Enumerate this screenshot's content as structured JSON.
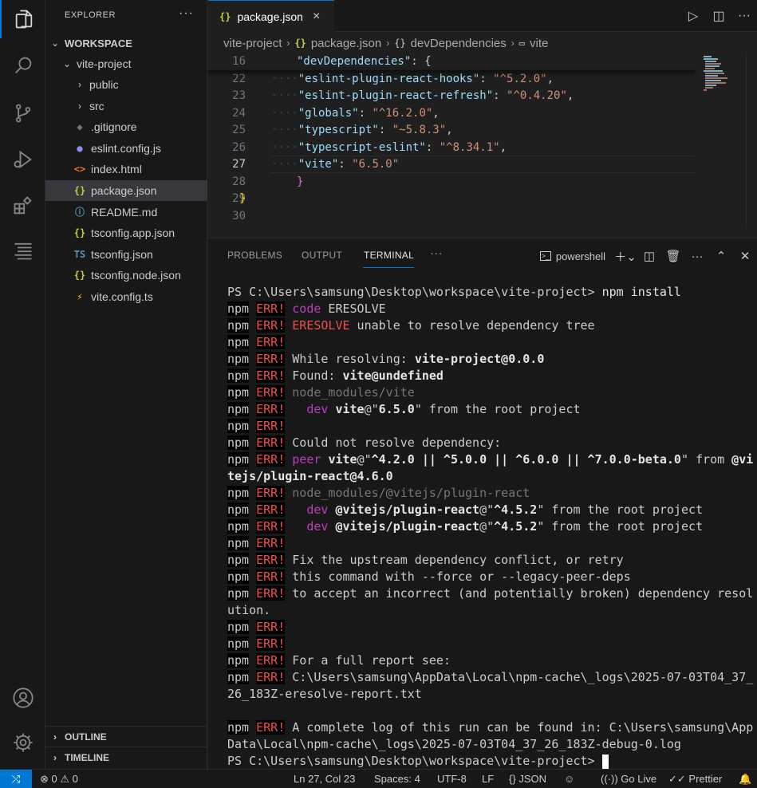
{
  "activity_bar": {
    "items": [
      "explorer-icon",
      "search-icon",
      "source-control-icon",
      "run-debug-icon",
      "extensions-icon",
      "outline-icon"
    ],
    "bottom": [
      "account-icon",
      "settings-gear-icon"
    ]
  },
  "sidebar": {
    "title": "EXPLORER",
    "more": "···",
    "workspace": "WORKSPACE",
    "project": "vite-project",
    "items": [
      {
        "label": "public",
        "type": "folder"
      },
      {
        "label": "src",
        "type": "folder"
      },
      {
        "label": ".gitignore",
        "type": "file",
        "icon": "◆",
        "color": "#6e7681"
      },
      {
        "label": "eslint.config.js",
        "type": "file",
        "icon": "●",
        "color": "#8d8df5"
      },
      {
        "label": "index.html",
        "type": "file",
        "icon": "<>",
        "color": "#e37933"
      },
      {
        "label": "package.json",
        "type": "file",
        "icon": "{}",
        "color": "#cbcb41",
        "selected": true
      },
      {
        "label": "README.md",
        "type": "file",
        "icon": "ⓘ",
        "color": "#519aba"
      },
      {
        "label": "tsconfig.app.json",
        "type": "file",
        "icon": "{}",
        "color": "#cbcb41"
      },
      {
        "label": "tsconfig.json",
        "type": "file",
        "icon": "TS",
        "color": "#519aba"
      },
      {
        "label": "tsconfig.node.json",
        "type": "file",
        "icon": "{}",
        "color": "#cbcb41"
      },
      {
        "label": "vite.config.ts",
        "type": "file",
        "icon": "⚡",
        "color": "#ffd700"
      }
    ],
    "sections": [
      "OUTLINE",
      "TIMELINE"
    ]
  },
  "tab": {
    "label": "package.json",
    "icon": "{}",
    "close": "×"
  },
  "breadcrumb": {
    "items": [
      "vite-project",
      "package.json",
      "devDependencies",
      "vite"
    ]
  },
  "editor": {
    "lines": [
      {
        "n": "16",
        "indent": "  ",
        "key": "\"devDependencies\"",
        "val": "",
        "tail": ": {",
        "sticky": true
      },
      {
        "n": "22",
        "indent": "    ",
        "key": "\"eslint-plugin-react-hooks\"",
        "val": "\"^5.2.0\"",
        "tail": ","
      },
      {
        "n": "23",
        "indent": "    ",
        "key": "\"eslint-plugin-react-refresh\"",
        "val": "\"^0.4.20\"",
        "tail": ","
      },
      {
        "n": "24",
        "indent": "    ",
        "key": "\"globals\"",
        "val": "\"^16.2.0\"",
        "tail": ","
      },
      {
        "n": "25",
        "indent": "    ",
        "key": "\"typescript\"",
        "val": "\"~5.8.3\"",
        "tail": ","
      },
      {
        "n": "26",
        "indent": "    ",
        "key": "\"typescript-eslint\"",
        "val": "\"^8.34.1\"",
        "tail": ","
      },
      {
        "n": "27",
        "indent": "    ",
        "key": "\"vite\"",
        "val": "\"6.5.0\"",
        "tail": "",
        "active": true
      },
      {
        "n": "28",
        "indent": "  ",
        "key": "",
        "val": "",
        "tail": "}",
        "brace": true
      },
      {
        "n": "29",
        "indent": "",
        "key": "",
        "val": "",
        "tail": "}",
        "brace0": true
      },
      {
        "n": "30",
        "indent": "",
        "key": "",
        "val": "",
        "tail": ""
      }
    ]
  },
  "panel": {
    "tabs": [
      "PROBLEMS",
      "OUTPUT",
      "TERMINAL",
      "···"
    ],
    "active_tab": "TERMINAL",
    "shell": "powershell"
  },
  "terminal": {
    "prompt_cmd_prefix": "PS C:\\Users\\samsung\\Desktop\\workspace\\vite-project> ",
    "command": "npm install",
    "final_prompt": "PS C:\\Users\\samsung\\Desktop\\workspace\\vite-project> ",
    "lines": [
      [
        {
          "t": "npm",
          "c": "npm"
        },
        {
          "t": " "
        },
        {
          "t": "ERR!",
          "c": "err"
        },
        {
          "t": " "
        },
        {
          "t": "code",
          "c": "mag"
        },
        {
          "t": " ERESOLVE"
        }
      ],
      [
        {
          "t": "npm",
          "c": "npm"
        },
        {
          "t": " "
        },
        {
          "t": "ERR!",
          "c": "err"
        },
        {
          "t": " "
        },
        {
          "t": "ERESOLVE",
          "c": "red"
        },
        {
          "t": " unable to resolve dependency tree"
        }
      ],
      [
        {
          "t": "npm",
          "c": "npm"
        },
        {
          "t": " "
        },
        {
          "t": "ERR!",
          "c": "err"
        }
      ],
      [
        {
          "t": "npm",
          "c": "npm"
        },
        {
          "t": " "
        },
        {
          "t": "ERR!",
          "c": "err"
        },
        {
          "t": " While resolving: "
        },
        {
          "t": "vite-project@0.0.0",
          "c": "bold"
        }
      ],
      [
        {
          "t": "npm",
          "c": "npm"
        },
        {
          "t": " "
        },
        {
          "t": "ERR!",
          "c": "err"
        },
        {
          "t": " Found: "
        },
        {
          "t": "vite@undefined",
          "c": "bold"
        }
      ],
      [
        {
          "t": "npm",
          "c": "npm"
        },
        {
          "t": " "
        },
        {
          "t": "ERR!",
          "c": "err"
        },
        {
          "t": " "
        },
        {
          "t": "node_modules/vite",
          "c": "gray"
        }
      ],
      [
        {
          "t": "npm",
          "c": "npm"
        },
        {
          "t": " "
        },
        {
          "t": "ERR!",
          "c": "err"
        },
        {
          "t": "   "
        },
        {
          "t": "dev",
          "c": "mag"
        },
        {
          "t": " "
        },
        {
          "t": "vite",
          "c": "bold"
        },
        {
          "t": "@\""
        },
        {
          "t": "6.5.0",
          "c": "bold"
        },
        {
          "t": "\" from the root project"
        }
      ],
      [
        {
          "t": "npm",
          "c": "npm"
        },
        {
          "t": " "
        },
        {
          "t": "ERR!",
          "c": "err"
        }
      ],
      [
        {
          "t": "npm",
          "c": "npm"
        },
        {
          "t": " "
        },
        {
          "t": "ERR!",
          "c": "err"
        },
        {
          "t": " Could not resolve dependency:"
        }
      ],
      [
        {
          "t": "npm",
          "c": "npm"
        },
        {
          "t": " "
        },
        {
          "t": "ERR!",
          "c": "err"
        },
        {
          "t": " "
        },
        {
          "t": "peer",
          "c": "mag"
        },
        {
          "t": " "
        },
        {
          "t": "vite",
          "c": "bold"
        },
        {
          "t": "@\""
        },
        {
          "t": "^4.2.0 || ^5.0.0 || ^6.0.0 || ^7.0.0-beta.0",
          "c": "bold"
        },
        {
          "t": "\" from "
        },
        {
          "t": "@vi",
          "c": "bold"
        }
      ],
      [
        {
          "t": "tejs/plugin-react@4.6.0",
          "c": "bold"
        }
      ],
      [
        {
          "t": "npm",
          "c": "npm"
        },
        {
          "t": " "
        },
        {
          "t": "ERR!",
          "c": "err"
        },
        {
          "t": " "
        },
        {
          "t": "node_modules/@vitejs/plugin-react",
          "c": "gray"
        }
      ],
      [
        {
          "t": "npm",
          "c": "npm"
        },
        {
          "t": " "
        },
        {
          "t": "ERR!",
          "c": "err"
        },
        {
          "t": "   "
        },
        {
          "t": "dev",
          "c": "mag"
        },
        {
          "t": " "
        },
        {
          "t": "@vitejs/plugin-react",
          "c": "bold"
        },
        {
          "t": "@\""
        },
        {
          "t": "^4.5.2",
          "c": "bold"
        },
        {
          "t": "\" from the root project"
        }
      ],
      [
        {
          "t": "npm",
          "c": "npm"
        },
        {
          "t": " "
        },
        {
          "t": "ERR!",
          "c": "err"
        },
        {
          "t": "   "
        },
        {
          "t": "dev",
          "c": "mag"
        },
        {
          "t": " "
        },
        {
          "t": "@vitejs/plugin-react",
          "c": "bold"
        },
        {
          "t": "@\""
        },
        {
          "t": "^4.5.2",
          "c": "bold"
        },
        {
          "t": "\" from the root project"
        }
      ],
      [
        {
          "t": "npm",
          "c": "npm"
        },
        {
          "t": " "
        },
        {
          "t": "ERR!",
          "c": "err"
        }
      ],
      [
        {
          "t": "npm",
          "c": "npm"
        },
        {
          "t": " "
        },
        {
          "t": "ERR!",
          "c": "err"
        },
        {
          "t": " Fix the upstream dependency conflict, or retry"
        }
      ],
      [
        {
          "t": "npm",
          "c": "npm"
        },
        {
          "t": " "
        },
        {
          "t": "ERR!",
          "c": "err"
        },
        {
          "t": " this command with --force or --legacy-peer-deps"
        }
      ],
      [
        {
          "t": "npm",
          "c": "npm"
        },
        {
          "t": " "
        },
        {
          "t": "ERR!",
          "c": "err"
        },
        {
          "t": " to accept an incorrect (and potentially broken) dependency resol"
        }
      ],
      [
        {
          "t": "ution."
        }
      ],
      [
        {
          "t": "npm",
          "c": "npm"
        },
        {
          "t": " "
        },
        {
          "t": "ERR!",
          "c": "err"
        }
      ],
      [
        {
          "t": "npm",
          "c": "npm"
        },
        {
          "t": " "
        },
        {
          "t": "ERR!",
          "c": "err"
        }
      ],
      [
        {
          "t": "npm",
          "c": "npm"
        },
        {
          "t": " "
        },
        {
          "t": "ERR!",
          "c": "err"
        },
        {
          "t": " For a full report see:"
        }
      ],
      [
        {
          "t": "npm",
          "c": "npm"
        },
        {
          "t": " "
        },
        {
          "t": "ERR!",
          "c": "err"
        },
        {
          "t": " C:\\Users\\samsung\\AppData\\Local\\npm-cache\\_logs\\2025-07-03T04_37_"
        }
      ],
      [
        {
          "t": "26_183Z-eresolve-report.txt"
        }
      ],
      [
        {
          "t": ""
        }
      ],
      [
        {
          "t": "npm",
          "c": "npm"
        },
        {
          "t": " "
        },
        {
          "t": "ERR!",
          "c": "err"
        },
        {
          "t": " A complete log of this run can be found in: C:\\Users\\samsung\\App"
        }
      ],
      [
        {
          "t": "Data\\Local\\npm-cache\\_logs\\2025-07-03T04_37_26_183Z-debug-0.log"
        }
      ]
    ]
  },
  "status": {
    "errors": "0",
    "warnings": "0",
    "position": "Ln 27, Col 23",
    "spaces": "Spaces: 4",
    "encoding": "UTF-8",
    "eol": "LF",
    "language": "JSON",
    "golive": "Go Live",
    "prettier": "Prettier"
  }
}
